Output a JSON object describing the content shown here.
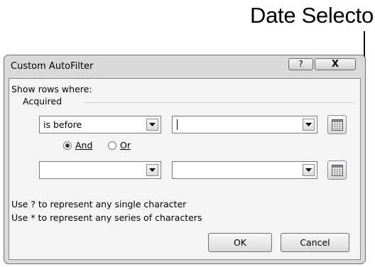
{
  "callout": {
    "label": "Date Selector"
  },
  "dialog": {
    "title": "Custom AutoFilter",
    "help_label": "?",
    "close_label": "X",
    "show_rows_label": "Show rows where:",
    "field_name": "Acquired",
    "condition1": {
      "operator": "is before",
      "value": ""
    },
    "and_label": "And",
    "or_label": "Or",
    "and_selected": true,
    "condition2": {
      "operator": "",
      "value": ""
    },
    "hint1": "Use ? to represent any single character",
    "hint2": "Use * to represent any series of characters",
    "ok_label": "OK",
    "cancel_label": "Cancel"
  },
  "icons": [
    "help-icon",
    "close-icon",
    "dropdown-arrow-icon",
    "calendar-icon"
  ]
}
